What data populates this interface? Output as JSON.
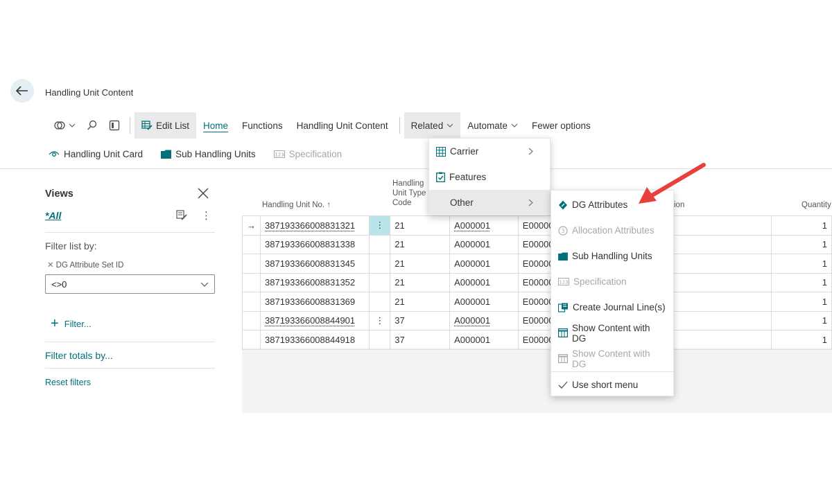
{
  "page": {
    "title": "Handling Unit Content"
  },
  "actionbar": {
    "edit_list": "Edit List",
    "home": "Home",
    "functions": "Functions",
    "handling_unit_content": "Handling Unit Content",
    "related": "Related",
    "automate": "Automate",
    "fewer_options": "Fewer options"
  },
  "promoted": {
    "handling_unit_card": "Handling Unit Card",
    "sub_handling_units": "Sub Handling Units",
    "specification": "Specification"
  },
  "filter_pane": {
    "views_title": "Views",
    "view_all": "*All",
    "filter_list_by": "Filter list by:",
    "field_label": "DG Attribute Set ID",
    "field_value": "<>0",
    "add_filter": "Filter...",
    "filter_totals_by": "Filter totals by...",
    "reset_filters": "Reset filters"
  },
  "grid": {
    "headers": {
      "handling_unit_no": "Handling Unit No.",
      "type_line1": "Handling",
      "type_line2": "Unit Type",
      "type_line3": "Code",
      "description_partial": "ion",
      "quantity": "Quantity"
    },
    "rows": [
      {
        "no": "387193366008831321",
        "type": "21",
        "a": "A000001",
        "e": "E00000",
        "qty": "1"
      },
      {
        "no": "387193366008831338",
        "type": "21",
        "a": "A000001",
        "e": "E00000",
        "qty": "1"
      },
      {
        "no": "387193366008831345",
        "type": "21",
        "a": "A000001",
        "e": "E00000",
        "qty": "1"
      },
      {
        "no": "387193366008831352",
        "type": "21",
        "a": "A000001",
        "e": "E00000",
        "qty": "1"
      },
      {
        "no": "387193366008831369",
        "type": "21",
        "a": "A000001",
        "e": "E00000",
        "qty": "1"
      },
      {
        "no": "387193366008844901",
        "type": "37",
        "a": "A000001",
        "e": "E00000",
        "qty": "1"
      },
      {
        "no": "387193366008844918",
        "type": "37",
        "a": "A000001",
        "e": "E00000",
        "qty": "1"
      }
    ]
  },
  "related_menu": {
    "carrier": "Carrier",
    "features": "Features",
    "other": "Other"
  },
  "other_menu": {
    "dg_attributes": "DG Attributes",
    "allocation_attributes": "Allocation Attributes",
    "sub_handling_units": "Sub Handling Units",
    "specification": "Specification",
    "create_journal_lines": "Create Journal Line(s)",
    "show_content_with_dg_1": "Show Content with DG",
    "show_content_with_dg_2": "Show Content with DG",
    "use_short_menu": "Use short menu"
  },
  "colors": {
    "accent": "#00707a",
    "annotation_arrow": "#e8403c",
    "selected_cell": "#b9e4ea"
  }
}
